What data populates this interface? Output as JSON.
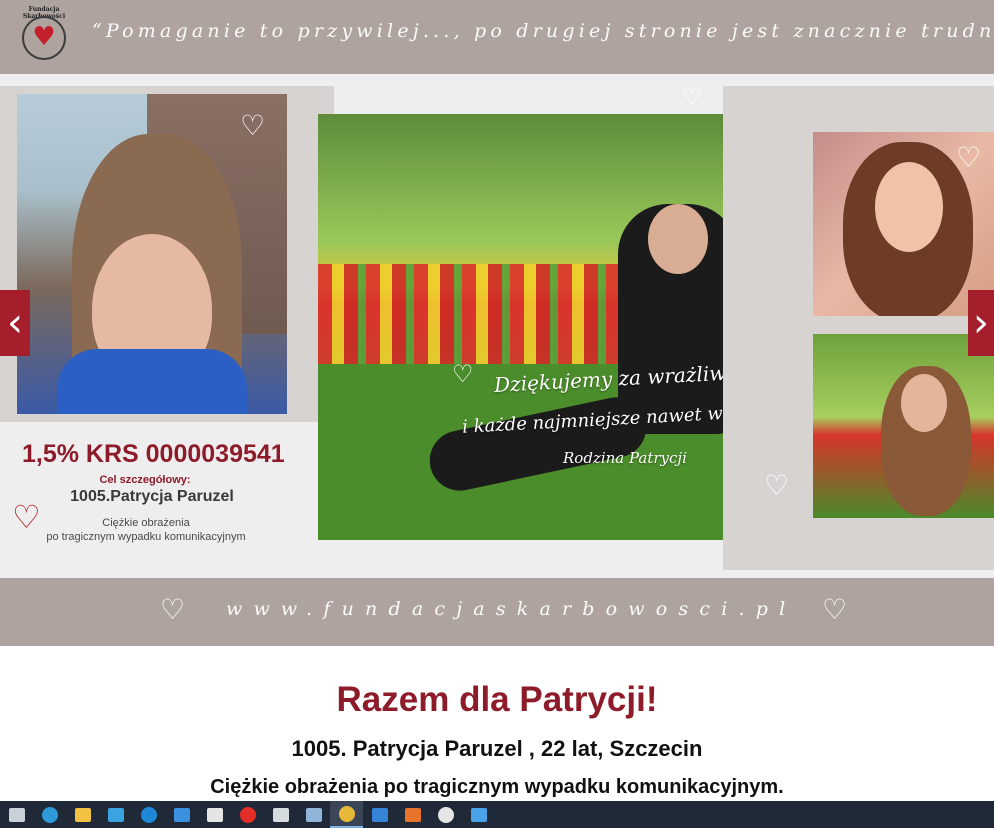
{
  "banner": {
    "logo_text": "Fundacja Skarbowości",
    "quote": "“Pomaganie to przywilej..., po drugiej stronie jest znacznie trudniej!",
    "website": "www.fundacjaskarbowosci.pl",
    "overlay": {
      "line1": "Dziękujemy za wrażliwość",
      "line2": "i każde najmniejsze nawet wsparcie!",
      "signature": "Rodzina Patrycji"
    },
    "krs": "1,5% KRS 0000039541",
    "goal_label": "Cel szczegółowy:",
    "goal_name": "1005.Patrycja Paruzel",
    "goal_desc_line1": "Ciężkie obrażenia",
    "goal_desc_line2": "po tragicznym wypadku komunikacyjnym",
    "nav_prev": "‹",
    "nav_next": "›"
  },
  "article": {
    "title": "Razem dla Patrycji!",
    "subtitle": "1005. Patrycja Paruzel , 22 lat, Szczecin",
    "description": "Ciężkie obrażenia po tragicznym wypadku komunikacyjnym."
  },
  "taskbar": {
    "items": [
      {
        "name": "task-view-icon",
        "color": "#c9d1d9"
      },
      {
        "name": "edge-icon",
        "color": "#2f9ad8"
      },
      {
        "name": "file-explorer-icon",
        "color": "#f4c242"
      },
      {
        "name": "edge-alt-icon",
        "color": "#3aa3e0"
      },
      {
        "name": "edge-legacy-icon",
        "color": "#1e88d6"
      },
      {
        "name": "mail-icon",
        "color": "#3d8fe0"
      },
      {
        "name": "store-icon",
        "color": "#e5e5e5"
      },
      {
        "name": "youtube-icon",
        "color": "#e52d27"
      },
      {
        "name": "document-icon",
        "color": "#d6dbe0"
      },
      {
        "name": "app-icon",
        "color": "#8fb6d8"
      },
      {
        "name": "chrome-icon",
        "color": "#e8b83a"
      },
      {
        "name": "browser-icon",
        "color": "#3584d8"
      },
      {
        "name": "firefox-icon",
        "color": "#e8742c"
      },
      {
        "name": "printer-icon",
        "color": "#e5e5e5"
      },
      {
        "name": "photos-icon",
        "color": "#4aa3e8"
      }
    ],
    "active_index": 10
  }
}
